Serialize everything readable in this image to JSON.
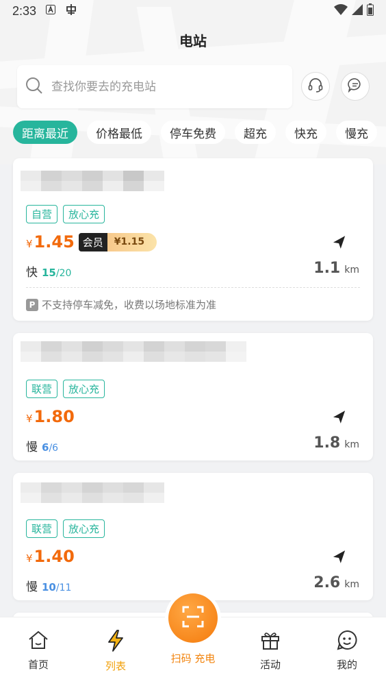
{
  "status_bar": {
    "time": "2:33"
  },
  "page_title": "电站",
  "search": {
    "placeholder": "查找你要去的充电站"
  },
  "filters": [
    "距离最近",
    "价格最低",
    "停车免费",
    "超充",
    "快充",
    "慢充"
  ],
  "stations": [
    {
      "tags": [
        "自营",
        "放心充"
      ],
      "currency": "¥",
      "price": "1.45",
      "member_label": "会员",
      "member_price": "¥1.15",
      "speed_label": "快",
      "available": "15",
      "total": "/20",
      "distance": "1.1",
      "unit": "km",
      "parking_icon": "P",
      "parking_note": "不支持停车减免，收费以场地标准为准"
    },
    {
      "tags": [
        "联营",
        "放心充"
      ],
      "currency": "¥",
      "price": "1.80",
      "speed_label": "慢",
      "available": "6",
      "total": "/6",
      "distance": "1.8",
      "unit": "km"
    },
    {
      "tags": [
        "联营",
        "放心充"
      ],
      "currency": "¥",
      "price": "1.40",
      "speed_label": "慢",
      "available": "10",
      "total": "/11",
      "distance": "2.6",
      "unit": "km"
    }
  ],
  "tabbar": {
    "home": "首页",
    "list": "列表",
    "scan": "扫码 充电",
    "activity": "活动",
    "mine": "我的"
  },
  "colors": {
    "accent": "#27b59c",
    "price": "#f26a0c",
    "tab_active": "#f2a10c"
  }
}
